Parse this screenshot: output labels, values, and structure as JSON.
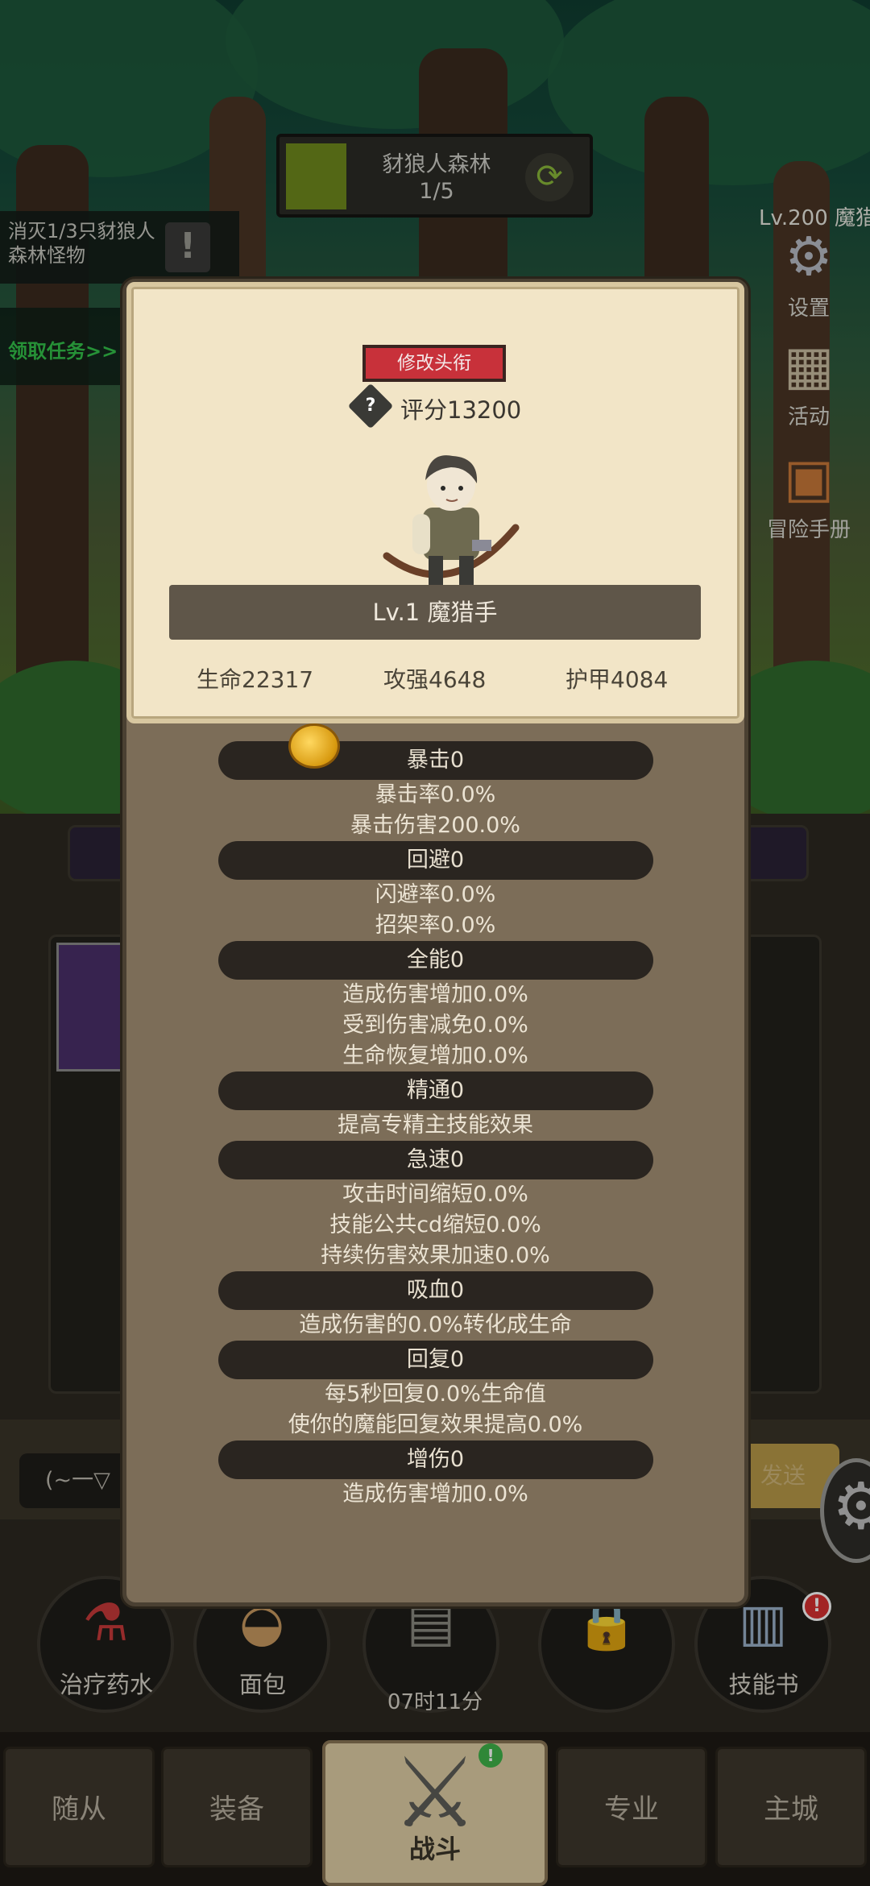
{
  "stage": {
    "name": "豺狼人森林",
    "progress": "1/5",
    "swap_icon": "refresh-icon"
  },
  "quest": {
    "text": "消灭1/3只豺狼人森林怪物",
    "alert_glyph": "!",
    "claim_label": "领取任务>>"
  },
  "player": {
    "level_label": "Lv.200 魔猎"
  },
  "side_buttons": [
    {
      "label": "设置",
      "icon": "gear-icon",
      "glyph": "⚙"
    },
    {
      "label": "活动",
      "icon": "calendar-icon",
      "glyph": "▦"
    },
    {
      "label": "冒险手册",
      "icon": "book-icon",
      "glyph": "▣"
    }
  ],
  "profile": {
    "title_button": "修改头衔",
    "score_help_glyph": "?",
    "score": "评分13200",
    "class_label": "Lv.1 魔猎手",
    "hp": "生命22317",
    "attack": "攻强4648",
    "armor": "护甲4084"
  },
  "stats": [
    {
      "header": "暴击0",
      "lines": [
        "暴击率0.0%",
        "暴击伤害200.0%"
      ]
    },
    {
      "header": "回避0",
      "lines": [
        "闪避率0.0%",
        "招架率0.0%"
      ]
    },
    {
      "header": "全能0",
      "lines": [
        "造成伤害增加0.0%",
        "受到伤害减免0.0%",
        "生命恢复增加0.0%"
      ]
    },
    {
      "header": "精通0",
      "lines": [
        "提高专精主技能效果"
      ]
    },
    {
      "header": "急速0",
      "lines": [
        "攻击时间缩短0.0%",
        "技能公共cd缩短0.0%",
        "持续伤害效果加速0.0%"
      ]
    },
    {
      "header": "吸血0",
      "lines": [
        "造成伤害的0.0%转化成生命"
      ]
    },
    {
      "header": "回复0",
      "lines": [
        "每5秒回复0.0%生命值",
        "使你的魔能回复效果提高0.0%"
      ]
    },
    {
      "header": "增伤0",
      "lines": [
        "造成伤害增加0.0%"
      ]
    }
  ],
  "chat": {
    "input_text": "(~一▽",
    "send_label": "发送"
  },
  "items": [
    {
      "label": "治疗药水",
      "glyph": "⚗"
    },
    {
      "label": "面包",
      "glyph": "◒"
    },
    {
      "label": "",
      "glyph": "▤"
    },
    {
      "label": "",
      "glyph": "🔒"
    },
    {
      "label": "技能书",
      "glyph": "▥"
    }
  ],
  "skill_badge": "!",
  "timer": "07时11分",
  "tabs": {
    "followers": "随从",
    "equipment": "装备",
    "battle": "战斗",
    "profession": "专业",
    "city": "主城",
    "battle_badge": "!"
  },
  "colors": {
    "title_button": "#c8313a",
    "card": "#f2e5c7",
    "modal": "#7c6d58",
    "quest_claim": "#33c24a"
  }
}
